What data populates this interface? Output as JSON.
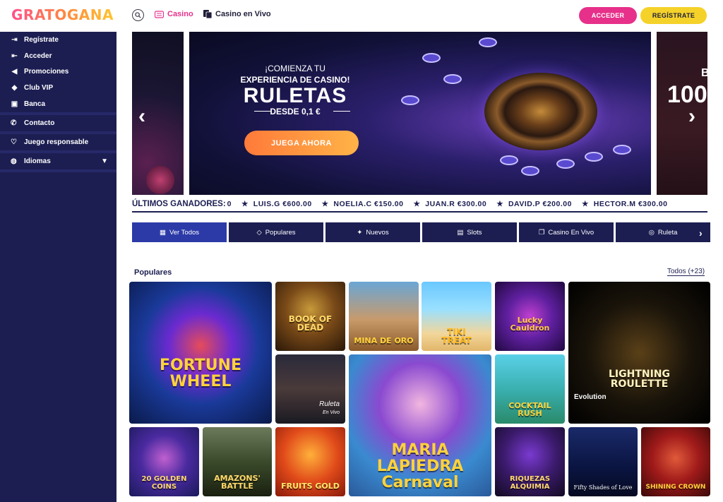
{
  "header": {
    "logo": "GRATOGANA",
    "nav_casino": "Casino",
    "nav_vivo": "Casino en Vivo",
    "acceder": "ACCEDER",
    "registrate": "REGÍSTRATE"
  },
  "sidebar": {
    "group1": [
      {
        "label": "Regístrate",
        "icon": "register-icon"
      },
      {
        "label": "Acceder",
        "icon": "login-icon"
      },
      {
        "label": "Promociones",
        "icon": "megaphone-icon"
      },
      {
        "label": "Club VIP",
        "icon": "diamond-icon"
      },
      {
        "label": "Banca",
        "icon": "bank-icon"
      }
    ],
    "contacto": "Contacto",
    "juego": "Juego responsable",
    "idiomas": "Idiomas"
  },
  "hero": {
    "eyebrow": "¡COMIENZA TU",
    "line2": "EXPERIENCIA DE CASINO!",
    "title": "RULETAS",
    "sub": "DESDE 0,1 €",
    "cta": "JUEGA AHORA",
    "right_big": "100",
    "right_b": "B"
  },
  "winners": {
    "label": "ÚLTIMOS GANADORES:",
    "items": [
      {
        "text": "LUIS.G €600.00"
      },
      {
        "text": "NOELIA.C €150.00"
      },
      {
        "text": "JUAN.R €300.00"
      },
      {
        "text": "DAVID.P €200.00"
      },
      {
        "text": "HECTOR.M €300.00"
      }
    ],
    "lead": "0"
  },
  "categories": [
    {
      "label": "Ver Todos",
      "icon": "grid-icon"
    },
    {
      "label": "Populares",
      "icon": "diamond-icon"
    },
    {
      "label": "Nuevos",
      "icon": "sparkle-icon"
    },
    {
      "label": "Slots",
      "icon": "slot-icon"
    },
    {
      "label": "Casino En Vivo",
      "icon": "live-casino-icon"
    },
    {
      "label": "Ruleta",
      "icon": "roulette-icon"
    }
  ],
  "section": {
    "title": "Populares",
    "all": "Todos (+23)"
  },
  "games": {
    "fortune": "FORTUNE WHEEL",
    "book": "BOOK OF DEAD",
    "mina": "MINA DE ORO",
    "tiki": "TIKI TREAT",
    "lucky": "Lucky Cauldron",
    "lightning": "LIGHTNING ROULETTE",
    "ruleta": "Ruleta",
    "ruleta_sub": "En Vivo",
    "maria": "MARIA LAPIEDRA Carnaval",
    "cocktail": "COCKTAIL RUSH",
    "golden": "20 GOLDEN COINS",
    "amazons": "AMAZONS' BATTLE",
    "fruits": "FRUITS GOLD",
    "riquezas": "RIQUEZAS ALQUIMIA",
    "fifty": "Fifty Shades of Love",
    "shining": "SHINING CROWN",
    "evolution": "Evolution"
  }
}
